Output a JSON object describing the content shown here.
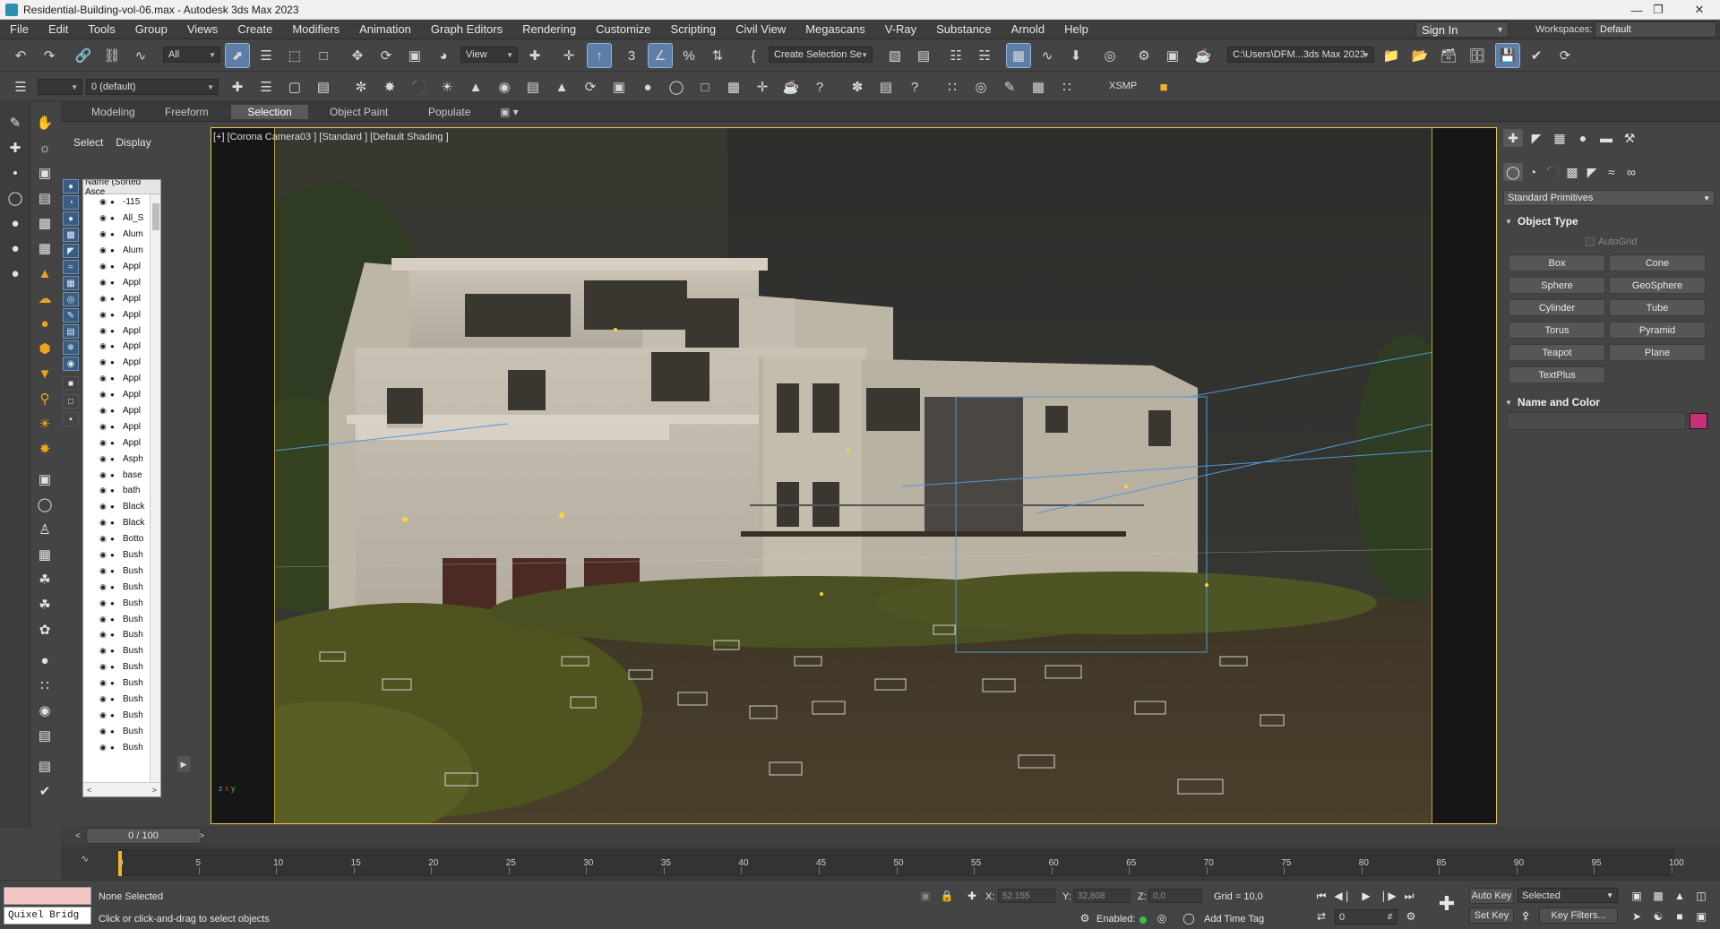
{
  "window": {
    "title": "Residential-Building-vol-06.max - Autodesk 3ds Max 2023"
  },
  "menu": [
    "File",
    "Edit",
    "Tools",
    "Group",
    "Views",
    "Create",
    "Modifiers",
    "Animation",
    "Graph Editors",
    "Rendering",
    "Customize",
    "Scripting",
    "Civil View",
    "Megascans",
    "V-Ray",
    "Substance",
    "Arnold",
    "Help"
  ],
  "account": {
    "sign_in": "Sign In",
    "workspaces_label": "Workspaces:",
    "workspace": "Default"
  },
  "toolbar": {
    "selection_filter": "All",
    "ref_coord": "View",
    "named_selection": "Create Selection Se",
    "project_path": "C:\\Users\\DFM...3ds Max 2023",
    "layer": "0 (default)",
    "xsmp": "XSMP"
  },
  "ribbon_tabs": [
    "Modeling",
    "Freeform",
    "Selection",
    "Object Paint",
    "Populate"
  ],
  "ribbon_active": "Selection",
  "explorer": {
    "tabs": [
      "Select",
      "Display"
    ],
    "column_header": "Name (Sorted Asce",
    "rows": [
      "-115",
      "All_S",
      "Alum",
      "Alum",
      "Appl",
      "Appl",
      "Appl",
      "Appl",
      "Appl",
      "Appl",
      "Appl",
      "Appl",
      "Appl",
      "Appl",
      "Appl",
      "Appl",
      "Asph",
      "base",
      "bath",
      "Black",
      "Black",
      "Botto",
      "Bush",
      "Bush",
      "Bush",
      "Bush",
      "Bush",
      "Bush",
      "Bush",
      "Bush",
      "Bush",
      "Bush",
      "Bush",
      "Bush",
      "Bush"
    ]
  },
  "viewport": {
    "label": "[+] [Corona Camera03 ] [Standard ] [Default Shading ]"
  },
  "command_panel": {
    "category": "Standard Primitives",
    "object_type_title": "Object Type",
    "autogrid": "AutoGrid",
    "buttons": [
      "Box",
      "Cone",
      "Sphere",
      "GeoSphere",
      "Cylinder",
      "Tube",
      "Torus",
      "Pyramid",
      "Teapot",
      "Plane",
      "TextPlus"
    ],
    "name_color_title": "Name and Color",
    "object_color": "#c8307a"
  },
  "timeline": {
    "position": "0 / 100",
    "ticks": [
      "0",
      "5",
      "10",
      "15",
      "20",
      "25",
      "30",
      "35",
      "40",
      "45",
      "50",
      "55",
      "60",
      "65",
      "70",
      "75",
      "80",
      "85",
      "90",
      "95",
      "100"
    ]
  },
  "status": {
    "quixel": "Quixel Bridg",
    "selection": "None Selected",
    "prompt": "Click or click-and-drag to select objects",
    "x_label": "X:",
    "x_value": "52,155",
    "y_label": "Y:",
    "y_value": "32,808",
    "z_label": "Z:",
    "z_value": "0,0",
    "grid": "Grid = 10,0",
    "enabled": "Enabled:",
    "add_time_tag": "Add Time Tag",
    "auto_key": "Auto Key",
    "set_key": "Set Key",
    "key_mode": "Selected",
    "key_filters": "Key Filters...",
    "frame": "0"
  },
  "colors": {
    "accent_blue": "#5d7ea6",
    "viewport_border": "#e8c94c",
    "timeline_cursor": "#f0b42a"
  }
}
